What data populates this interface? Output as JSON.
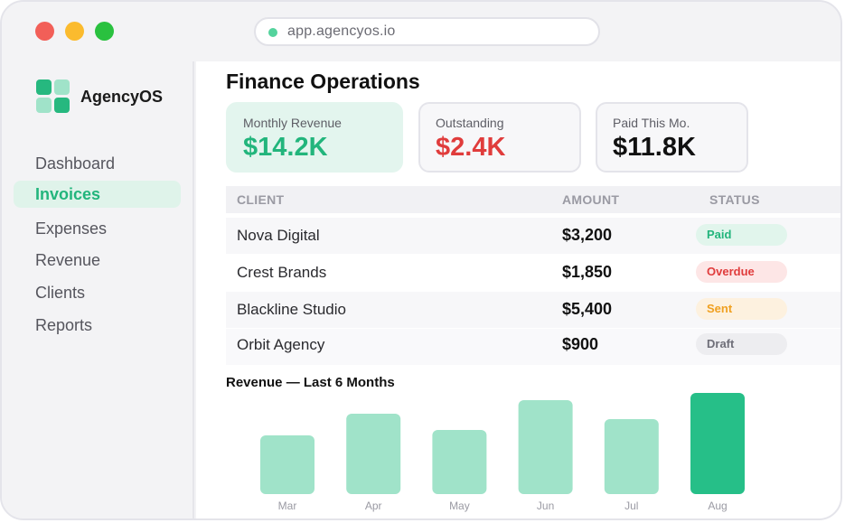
{
  "browser": {
    "url": "app.agencyos.io"
  },
  "brand": {
    "name": "AgencyOS"
  },
  "sidebar": {
    "items": [
      {
        "label": "Dashboard",
        "active": false
      },
      {
        "label": "Invoices",
        "active": true
      },
      {
        "label": "Expenses",
        "active": false
      },
      {
        "label": "Revenue",
        "active": false
      },
      {
        "label": "Clients",
        "active": false
      },
      {
        "label": "Reports",
        "active": false
      }
    ]
  },
  "main": {
    "title": "Finance Operations",
    "kpis": [
      {
        "label": "Monthly Revenue",
        "value": "$14.2K",
        "color": "#22b57c"
      },
      {
        "label": "Outstanding",
        "value": "$2.4K",
        "color": "#e03c3c"
      },
      {
        "label": "Paid This Mo.",
        "value": "$11.8K",
        "color": "#111111"
      }
    ],
    "table": {
      "headers": [
        "CLIENT",
        "AMOUNT",
        "STATUS"
      ],
      "rows": [
        {
          "client": "Nova Digital",
          "amount": "$3,200",
          "status": "Paid"
        },
        {
          "client": "Crest Brands",
          "amount": "$1,850",
          "status": "Overdue"
        },
        {
          "client": "Blackline Studio",
          "amount": "$5,400",
          "status": "Sent"
        },
        {
          "client": "Orbit Agency",
          "amount": "$900",
          "status": "Draft"
        }
      ]
    }
  },
  "chart_data": {
    "type": "bar",
    "title": "Revenue — Last 6 Months",
    "categories": [
      "Mar",
      "Apr",
      "May",
      "Jun",
      "Jul",
      "Aug"
    ],
    "values": [
      65,
      89,
      71,
      104,
      83,
      112
    ],
    "highlight_index": 5,
    "colors": {
      "bar": "#a0e3c9",
      "highlight": "#26bf88",
      "label": "#9a9aa3"
    },
    "ylim": [
      0,
      112
    ],
    "grid": false
  }
}
